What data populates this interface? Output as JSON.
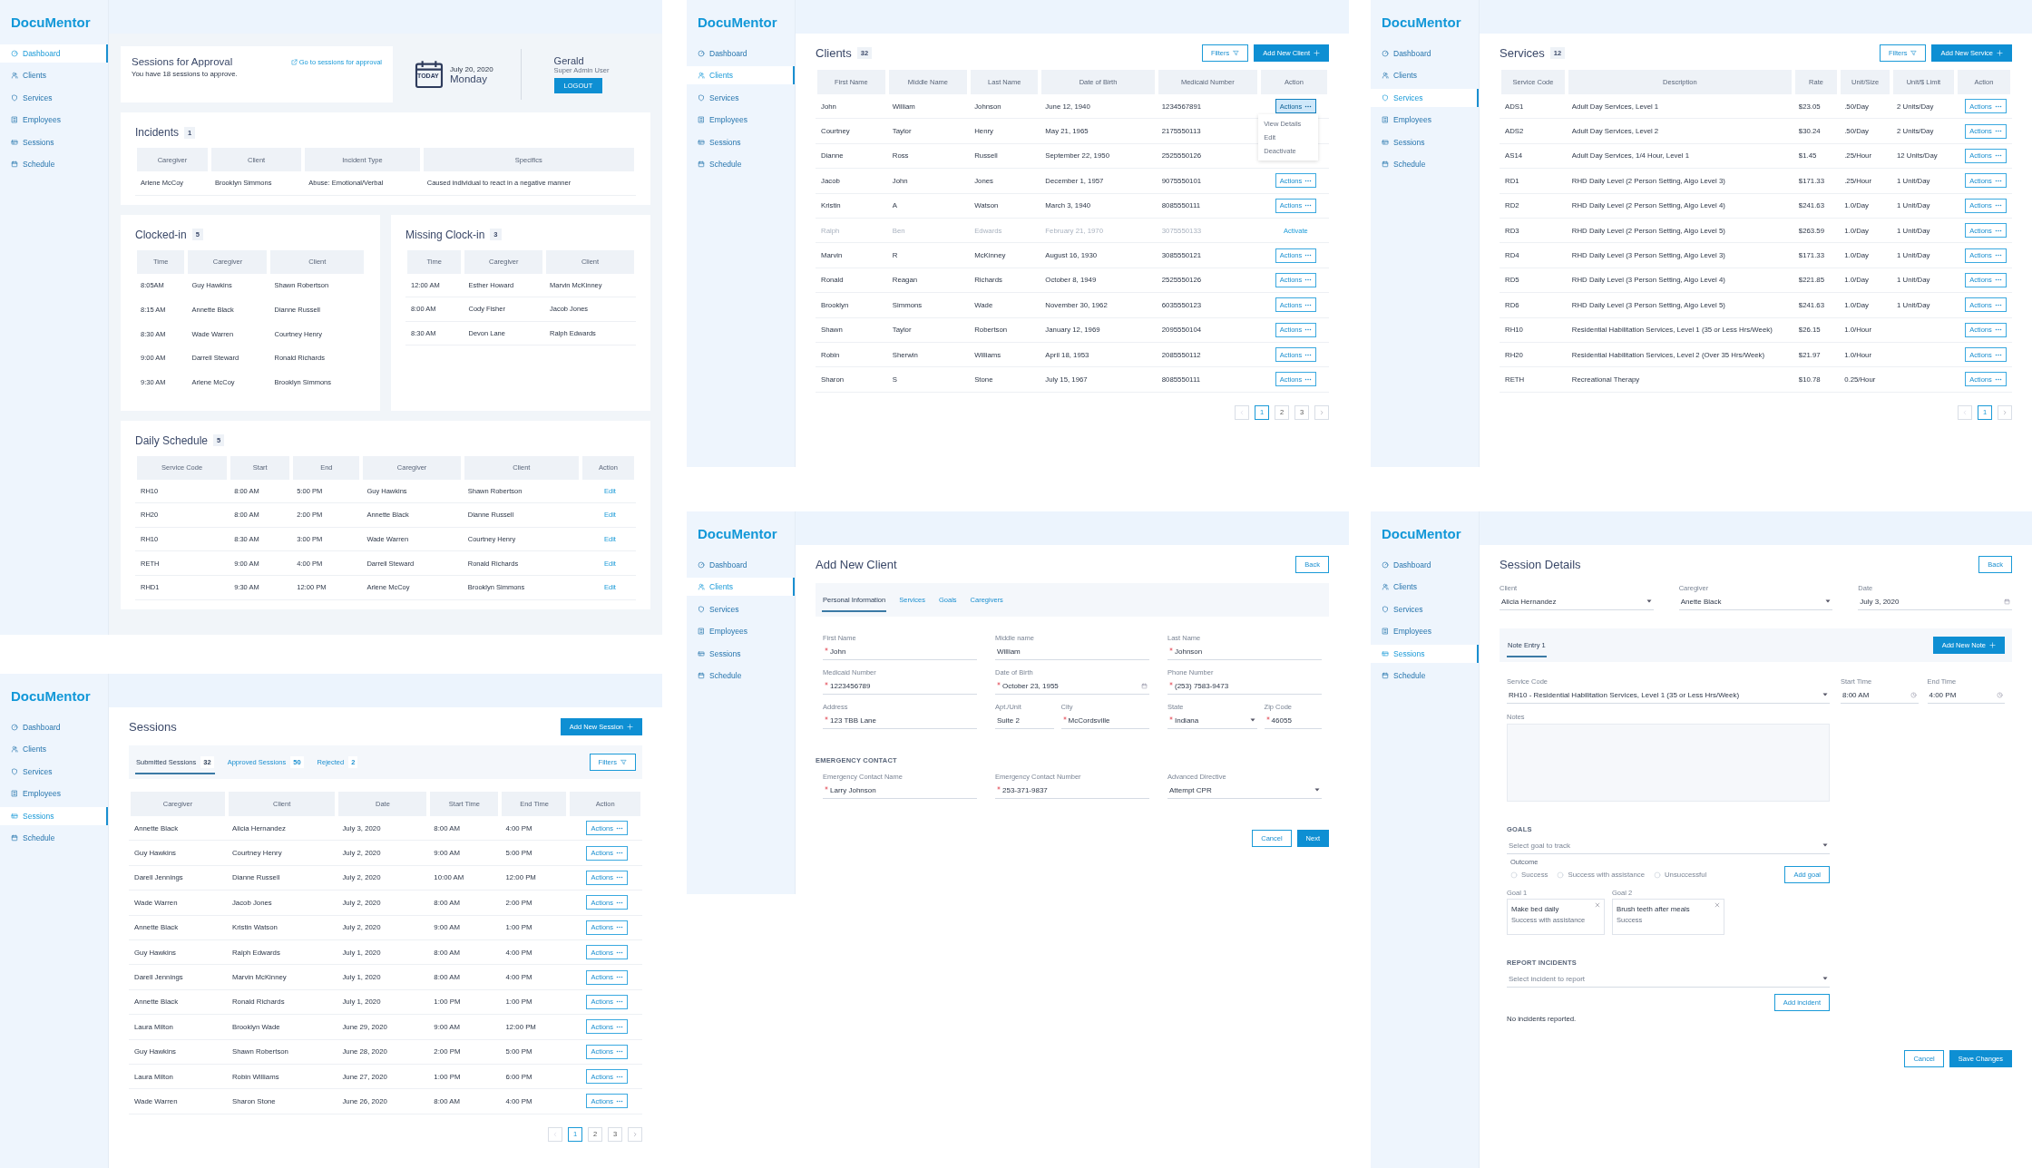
{
  "screens": [
    {
      "kind": "dashboard",
      "sidebar": {
        "logo": "DocuMentor",
        "items": [
          {
            "label": "Dashboard",
            "selected": true
          },
          {
            "label": "Clients",
            "selected": false
          },
          {
            "label": "Services",
            "selected": false
          },
          {
            "label": "Employees",
            "selected": false
          },
          {
            "label": "Sessions",
            "selected": false
          },
          {
            "label": "Schedule",
            "selected": false
          }
        ]
      },
      "approval": {
        "title": "Sessions for Approval",
        "text": "You have 18 sessions to approve.",
        "link": "Go to sessions for approval"
      },
      "date": {
        "badge": "TODAY",
        "date": "July 20, 2020",
        "day": "Monday"
      },
      "user": {
        "name": "Gerald",
        "role": "Super Admin User",
        "button": "LOGOUT"
      },
      "panels": [
        {
          "kind": "wide",
          "title": "Incidents",
          "count": "1",
          "table": {
            "columns": [
              "Caregiver",
              "Client",
              "Incident Type",
              "Specifics"
            ],
            "rows": [
              {
                "cells": [
                  "Arlene McCoy",
                  "Brooklyn Simmons",
                  "Abuse: Emotional/Verbal",
                  "Caused individual to react in a negative manner"
                ]
              }
            ]
          }
        },
        {
          "kind": "half",
          "title": "Clocked-in",
          "count": "5",
          "table": {
            "columns": [
              "Time",
              "Caregiver",
              "Client"
            ],
            "rows": [
              {
                "cells": [
                  "8:05AM",
                  "Guy Hawkins",
                  "Shawn Robertson"
                ]
              },
              {
                "cells": [
                  "8:15 AM",
                  "Annette Black",
                  "Dianne Russell"
                ]
              },
              {
                "cells": [
                  "8:30 AM",
                  "Wade Warren",
                  "Courtney Henry"
                ]
              },
              {
                "cells": [
                  "9:00 AM",
                  "Darrell Steward",
                  "Ronald Richards"
                ]
              },
              {
                "cells": [
                  "9:30 AM",
                  "Arlene McCoy",
                  "Brooklyn Simmons"
                ]
              }
            ]
          }
        },
        {
          "kind": "half",
          "title": "Missing Clock-in",
          "count": "3",
          "table": {
            "columns": [
              "Time",
              "Caregiver",
              "Client"
            ],
            "rows": [
              {
                "cells": [
                  "12:00 AM",
                  "Esther Howard",
                  "Marvin McKinney"
                ]
              },
              {
                "cells": [
                  "8:00 AM",
                  "Cody Fisher",
                  "Jacob Jones"
                ]
              },
              {
                "cells": [
                  "8:30 AM",
                  "Devon Lane",
                  "Ralph Edwards"
                ]
              }
            ]
          }
        },
        {
          "kind": "wide",
          "title": "Daily Schedule",
          "count": "5",
          "table": {
            "columns": [
              "Service Code",
              "Start",
              "End",
              "Caregiver",
              "Client",
              "Action"
            ],
            "rows": [
              {
                "cells": [
                  "RH10",
                  "8:00 AM",
                  "5:00 PM",
                  "Guy Hawkins",
                  "Shawn Robertson"
                ],
                "action": {
                  "kind": "link",
                  "label": "Edit"
                }
              },
              {
                "cells": [
                  "RH20",
                  "8:00 AM",
                  "2:00 PM",
                  "Annette Black",
                  "Dianne Russell"
                ],
                "action": {
                  "kind": "link",
                  "label": "Edit"
                }
              },
              {
                "cells": [
                  "RH10",
                  "8:30 AM",
                  "3:00 PM",
                  "Wade Warren",
                  "Courtney Henry"
                ],
                "action": {
                  "kind": "link",
                  "label": "Edit"
                }
              },
              {
                "cells": [
                  "RETH",
                  "9:00 AM",
                  "4:00 PM",
                  "Darrell Steward",
                  "Ronald Richards"
                ],
                "action": {
                  "kind": "link",
                  "label": "Edit"
                }
              },
              {
                "cells": [
                  "RHD1",
                  "9:30 AM",
                  "12:00 PM",
                  "Arlene McCoy",
                  "Brooklyn Simmons"
                ],
                "action": {
                  "kind": "link",
                  "label": "Edit"
                }
              }
            ]
          }
        }
      ]
    },
    {
      "kind": "list",
      "sidebar": {
        "logo": "DocuMentor",
        "items": [
          {
            "label": "Dashboard",
            "selected": false
          },
          {
            "label": "Clients",
            "selected": true
          },
          {
            "label": "Services",
            "selected": false
          },
          {
            "label": "Employees",
            "selected": false
          },
          {
            "label": "Sessions",
            "selected": false
          },
          {
            "label": "Schedule",
            "selected": false
          }
        ]
      },
      "title": "Clients",
      "count": "32",
      "filters": "Filters",
      "add_button": "Add New Client",
      "table": {
        "columns": [
          "First Name",
          "Middle Name",
          "Last Name",
          "Date of Birth",
          "Medicaid Number",
          "Action"
        ],
        "rows": [
          {
            "cells": [
              "John",
              "William",
              "Johnson",
              "June 12, 1940",
              "1234567891"
            ],
            "disabled": false,
            "action": {
              "kind": "menu",
              "label": "Actions",
              "expanded": true,
              "options": [
                "View Details",
                "Edit",
                "Deactivate"
              ]
            }
          },
          {
            "cells": [
              "Courtney",
              "Taylor",
              "Henry",
              "May 21, 1965",
              "2175550113"
            ],
            "disabled": false
          },
          {
            "cells": [
              "Dianne",
              "Ross",
              "Russell",
              "September 22, 1950",
              "2525550126"
            ],
            "disabled": false
          },
          {
            "cells": [
              "Jacob",
              "John",
              "Jones",
              "December 1, 1957",
              "9075550101"
            ],
            "disabled": false,
            "action": {
              "kind": "menu",
              "label": "Actions",
              "expanded": false
            }
          },
          {
            "cells": [
              "Kristin",
              "A",
              "Watson",
              "March 3, 1940",
              "8085550111"
            ],
            "disabled": false,
            "action": {
              "kind": "menu",
              "label": "Actions",
              "expanded": false
            }
          },
          {
            "cells": [
              "Ralph",
              "Ben",
              "Edwards",
              "February 21, 1970",
              "3075550133"
            ],
            "disabled": true,
            "action": {
              "kind": "link",
              "label": "Activate"
            }
          },
          {
            "cells": [
              "Marvin",
              "R",
              "McKinney",
              "August 16, 1930",
              "3085550121"
            ],
            "disabled": false,
            "action": {
              "kind": "menu",
              "label": "Actions",
              "expanded": false
            }
          },
          {
            "cells": [
              "Ronald",
              "Reagan",
              "Richards",
              "October 8, 1949",
              "2525550126"
            ],
            "disabled": false,
            "action": {
              "kind": "menu",
              "label": "Actions",
              "expanded": false
            }
          },
          {
            "cells": [
              "Brooklyn",
              "Simmons",
              "Wade",
              "November 30, 1962",
              "6035550123"
            ],
            "disabled": false,
            "action": {
              "kind": "menu",
              "label": "Actions",
              "expanded": false
            }
          },
          {
            "cells": [
              "Shawn",
              "Taylor",
              "Robertson",
              "January 12, 1969",
              "2095550104"
            ],
            "disabled": false,
            "action": {
              "kind": "menu",
              "label": "Actions",
              "expanded": false
            }
          },
          {
            "cells": [
              "Robin",
              "Sherwin",
              "Williams",
              "April 18, 1953",
              "2085550112"
            ],
            "disabled": false,
            "action": {
              "kind": "menu",
              "label": "Actions",
              "expanded": false
            }
          },
          {
            "cells": [
              "Sharon",
              "S",
              "Stone",
              "July 15, 1967",
              "8085550111"
            ],
            "disabled": false,
            "action": {
              "kind": "menu",
              "label": "Actions",
              "expanded": false
            }
          }
        ]
      },
      "pagination": [
        {
          "label": "1",
          "selected": true
        },
        {
          "label": "2",
          "selected": false
        },
        {
          "label": "3",
          "selected": false
        }
      ]
    },
    {
      "kind": "list",
      "sidebar": {
        "logo": "DocuMentor",
        "items": [
          {
            "label": "Dashboard",
            "selected": false
          },
          {
            "label": "Clients",
            "selected": false
          },
          {
            "label": "Services",
            "selected": true
          },
          {
            "label": "Employees",
            "selected": false
          },
          {
            "label": "Sessions",
            "selected": false
          },
          {
            "label": "Schedule",
            "selected": false
          }
        ]
      },
      "title": "Services",
      "count": "12",
      "filters": "Filters",
      "add_button": "Add New Service",
      "table": {
        "columns": [
          "Service Code",
          "Description",
          "Rate",
          "Unit/Size",
          "Unit/$ Limit",
          "Action"
        ],
        "rows": [
          {
            "cells": [
              "ADS1",
              "Adult Day Services, Level 1",
              "$23.05",
              ".50/Day",
              "2 Units/Day"
            ],
            "action": {
              "kind": "menu",
              "label": "Actions"
            }
          },
          {
            "cells": [
              "ADS2",
              "Adult Day Services, Level 2",
              "$30.24",
              ".50/Day",
              "2 Units/Day"
            ],
            "action": {
              "kind": "menu",
              "label": "Actions"
            }
          },
          {
            "cells": [
              "AS14",
              "Adult Day Services,  1/4 Hour, Level 1",
              "$1.45",
              ".25/Hour",
              "12 Units/Day"
            ],
            "action": {
              "kind": "menu",
              "label": "Actions"
            }
          },
          {
            "cells": [
              "RD1",
              "RHD Daily Level (2 Person Setting, Algo Level 3)",
              "$171.33",
              ".25/Hour",
              "1 Unit/Day"
            ],
            "action": {
              "kind": "menu",
              "label": "Actions"
            }
          },
          {
            "cells": [
              "RD2",
              "RHD Daily Level (2 Person Setting, Algo Level 4)",
              "$241.63",
              "1.0/Day",
              "1 Unit/Day"
            ],
            "action": {
              "kind": "menu",
              "label": "Actions"
            }
          },
          {
            "cells": [
              "RD3",
              "RHD Daily Level (2 Person Setting, Algo Level 5)",
              "$263.59",
              "1.0/Day",
              "1 Unit/Day"
            ],
            "action": {
              "kind": "menu",
              "label": "Actions"
            }
          },
          {
            "cells": [
              "RD4",
              "RHD Daily Level (3 Person Setting, Algo Level 3)",
              "$171.33",
              "1.0/Day",
              "1 Unit/Day"
            ],
            "action": {
              "kind": "menu",
              "label": "Actions"
            }
          },
          {
            "cells": [
              "RD5",
              "RHD Daily Level (3 Person Setting, Algo Level 4)",
              "$221.85",
              "1.0/Day",
              "1 Unit/Day"
            ],
            "action": {
              "kind": "menu",
              "label": "Actions"
            }
          },
          {
            "cells": [
              "RD6",
              "RHD Daily Level (3 Person Setting, Algo Level 5)",
              "$241.63",
              "1.0/Day",
              "1 Unit/Day"
            ],
            "action": {
              "kind": "menu",
              "label": "Actions"
            }
          },
          {
            "cells": [
              "RH10",
              "Residential Habilitation Services, Level 1 (35 or Less Hrs/Week)",
              "$26.15",
              "1.0/Hour",
              ""
            ],
            "action": {
              "kind": "menu",
              "label": "Actions"
            }
          },
          {
            "cells": [
              "RH20",
              "Residential Habilitation Services, Level 2 (Over 35 Hrs/Week)",
              "$21.97",
              "1.0/Hour",
              ""
            ],
            "action": {
              "kind": "menu",
              "label": "Actions"
            }
          },
          {
            "cells": [
              "RETH",
              "Recreational Therapy",
              "$10.78",
              "0.25/Hour",
              ""
            ],
            "action": {
              "kind": "menu",
              "label": "Actions"
            }
          }
        ]
      },
      "pagination": [
        {
          "label": "1",
          "selected": true
        }
      ]
    },
    {
      "kind": "list",
      "sidebar": {
        "logo": "DocuMentor",
        "items": [
          {
            "label": "Dashboard",
            "selected": false
          },
          {
            "label": "Clients",
            "selected": false
          },
          {
            "label": "Services",
            "selected": false
          },
          {
            "label": "Employees",
            "selected": false
          },
          {
            "label": "Sessions",
            "selected": true
          },
          {
            "label": "Schedule",
            "selected": false
          }
        ]
      },
      "title": "Sessions",
      "add_button": "Add New Session",
      "filters": "Filters",
      "tabs": [
        {
          "label": "Submitted Sessions",
          "count": "32",
          "selected": true
        },
        {
          "label": "Approved Sessions",
          "count": "50",
          "selected": false
        },
        {
          "label": "Rejected",
          "count": "2",
          "selected": false
        }
      ],
      "table": {
        "columns": [
          "Caregiver",
          "Client",
          "Date",
          "Start Time",
          "End Time",
          "Action"
        ],
        "rows": [
          {
            "cells": [
              "Annette Black",
              "Alicia Hernandez",
              "July 3, 2020",
              "8:00 AM",
              "4:00 PM"
            ],
            "action": {
              "kind": "menu",
              "label": "Actions"
            }
          },
          {
            "cells": [
              "Guy Hawkins",
              "Courtney Henry",
              "July 2, 2020",
              "9:00 AM",
              "5:00 PM"
            ],
            "action": {
              "kind": "menu",
              "label": "Actions"
            }
          },
          {
            "cells": [
              "Darell Jennings",
              "Dianne Russell",
              "July 2, 2020",
              "10:00 AM",
              "12:00 PM"
            ],
            "action": {
              "kind": "menu",
              "label": "Actions"
            }
          },
          {
            "cells": [
              "Wade Warren",
              "Jacob Jones",
              "July 2, 2020",
              "8:00 AM",
              "2:00 PM"
            ],
            "action": {
              "kind": "menu",
              "label": "Actions"
            }
          },
          {
            "cells": [
              "Annette Black",
              "Kristin Watson",
              "July 2, 2020",
              "9:00 AM",
              "1:00 PM"
            ],
            "action": {
              "kind": "menu",
              "label": "Actions"
            }
          },
          {
            "cells": [
              "Guy Hawkins",
              "Ralph Edwards",
              "July 1, 2020",
              "8:00 AM",
              "4:00 PM"
            ],
            "action": {
              "kind": "menu",
              "label": "Actions"
            }
          },
          {
            "cells": [
              "Darell Jennings",
              "Marvin McKinney",
              "July 1, 2020",
              "8:00 AM",
              "4:00 PM"
            ],
            "action": {
              "kind": "menu",
              "label": "Actions"
            }
          },
          {
            "cells": [
              "Annette Black",
              "Ronald Richards",
              "July 1, 2020",
              "1:00 PM",
              "1:00 PM"
            ],
            "action": {
              "kind": "menu",
              "label": "Actions"
            }
          },
          {
            "cells": [
              "Laura Milton",
              "Brooklyn Wade",
              "June 29, 2020",
              "9:00 AM",
              "12:00 PM"
            ],
            "action": {
              "kind": "menu",
              "label": "Actions"
            }
          },
          {
            "cells": [
              "Guy Hawkins",
              "Shawn Robertson",
              "June 28, 2020",
              "2:00 PM",
              "5:00 PM"
            ],
            "action": {
              "kind": "menu",
              "label": "Actions"
            }
          },
          {
            "cells": [
              "Laura Milton",
              "Robin Williams",
              "June 27, 2020",
              "1:00 PM",
              "6:00 PM"
            ],
            "action": {
              "kind": "menu",
              "label": "Actions"
            }
          },
          {
            "cells": [
              "Wade Warren",
              "Sharon Stone",
              "June 26, 2020",
              "8:00 AM",
              "4:00 PM"
            ],
            "action": {
              "kind": "menu",
              "label": "Actions"
            }
          }
        ]
      },
      "pagination": [
        {
          "label": "1",
          "selected": true
        },
        {
          "label": "2",
          "selected": false
        },
        {
          "label": "3",
          "selected": false
        }
      ]
    },
    {
      "kind": "form",
      "sidebar": {
        "logo": "DocuMentor",
        "items": [
          {
            "label": "Dashboard",
            "selected": false
          },
          {
            "label": "Clients",
            "selected": true
          },
          {
            "label": "Services",
            "selected": false
          },
          {
            "label": "Employees",
            "selected": false
          },
          {
            "label": "Sessions",
            "selected": false
          },
          {
            "label": "Schedule",
            "selected": false
          }
        ]
      },
      "title": "Add New Client",
      "back": "Back",
      "tabs": [
        {
          "label": "Personal Information",
          "selected": true
        },
        {
          "label": "Services",
          "selected": false
        },
        {
          "label": "Goals",
          "selected": false
        },
        {
          "label": "Caregivers",
          "selected": false
        }
      ],
      "sections": [
        {
          "rows": [
            [
              [
                {
                  "label": "First Name",
                  "value": "John",
                  "required": true,
                  "kind": "text"
                }
              ],
              [
                {
                  "label": "Middle name",
                  "value": "William",
                  "required": false,
                  "kind": "text"
                }
              ],
              [
                {
                  "label": "Last Name",
                  "value": "Johnson",
                  "required": true,
                  "kind": "text"
                }
              ]
            ],
            [
              [
                {
                  "label": "Medicaid Number",
                  "value": "1223456789",
                  "required": true,
                  "kind": "text"
                }
              ],
              [
                {
                  "label": "Date of Birth",
                  "value": "October 23, 1955",
                  "required": true,
                  "kind": "date"
                }
              ],
              [
                {
                  "label": "Phone Number",
                  "value": "(253) 7583-9473",
                  "required": true,
                  "kind": "text"
                }
              ]
            ],
            [
              [
                {
                  "label": "Address",
                  "value": "123 TBB Lane",
                  "required": true,
                  "kind": "text"
                }
              ],
              [
                {
                  "label": "Apt./Unit",
                  "value": "Suite 2",
                  "required": false,
                  "kind": "text"
                },
                {
                  "label": "City",
                  "value": "McCordsville",
                  "required": true,
                  "kind": "text"
                }
              ],
              [
                {
                  "label": "State",
                  "value": "Indiana",
                  "required": true,
                  "kind": "select"
                },
                {
                  "label": "Zip Code",
                  "value": "46055",
                  "required": true,
                  "kind": "text"
                }
              ]
            ]
          ]
        },
        {
          "heading": "EMERGENCY CONTACT",
          "rows": [
            [
              [
                {
                  "label": "Emergency Contact Name",
                  "value": "Larry Johnson",
                  "required": true,
                  "kind": "text"
                }
              ],
              [
                {
                  "label": "Emergency Contact Number",
                  "value": "253-371-9837",
                  "required": true,
                  "kind": "text"
                }
              ],
              [
                {
                  "label": "Advanced Directive",
                  "value": "Attempt CPR",
                  "required": false,
                  "kind": "select"
                }
              ]
            ]
          ]
        }
      ],
      "buttons": [
        {
          "label": "Cancel",
          "kind": "secondary"
        },
        {
          "label": "Next",
          "kind": "primary"
        }
      ]
    },
    {
      "kind": "session",
      "sidebar": {
        "logo": "DocuMentor",
        "items": [
          {
            "label": "Dashboard",
            "selected": false
          },
          {
            "label": "Clients",
            "selected": false
          },
          {
            "label": "Services",
            "selected": false
          },
          {
            "label": "Employees",
            "selected": false
          },
          {
            "label": "Sessions",
            "selected": true
          },
          {
            "label": "Schedule",
            "selected": false
          }
        ]
      },
      "title": "Session Details",
      "back": "Back",
      "fields": [
        {
          "label": "Client",
          "value": "Alicia Hernandez",
          "kind": "select"
        },
        {
          "label": "Caregiver",
          "value": "Anette Black",
          "kind": "select"
        },
        {
          "label": "Date",
          "value": "July 3, 2020",
          "kind": "date"
        }
      ],
      "note_tabs": [
        {
          "label": "Note Entry 1",
          "selected": true
        }
      ],
      "add_note": "Add New Note",
      "service": {
        "label": "Service Code",
        "value": "RH10 - Residential Habilitation Services, Level 1 (35 or Less Hrs/Week)",
        "kind": "select"
      },
      "times": [
        {
          "label": "Start Time",
          "value": "8:00 AM",
          "kind": "time"
        },
        {
          "label": "End Time",
          "value": "4:00 PM",
          "kind": "time"
        }
      ],
      "notes": {
        "label": "Notes"
      },
      "goals": {
        "heading": "GOALS",
        "select": {
          "placeholder": "Select goal to track",
          "kind": "select"
        },
        "outcome_label": "Outcome",
        "options": [
          {
            "label": "Success",
            "selected": false
          },
          {
            "label": "Success with assistance",
            "selected": false
          },
          {
            "label": "Unsuccessful",
            "selected": false
          }
        ],
        "add": "Add goal",
        "cards": [
          {
            "label": "Goal 1",
            "title": "Make bed daily",
            "outcome": "Success with assistance"
          },
          {
            "label": "Goal 2",
            "title": "Brush teeth after meals",
            "outcome": "Success"
          }
        ]
      },
      "incidents": {
        "heading": "REPORT INCIDENTS",
        "select": {
          "placeholder": "Select incident to report",
          "kind": "select"
        },
        "add": "Add incident",
        "empty": "No incidents reported."
      },
      "buttons": [
        {
          "label": "Cancel",
          "kind": "secondary"
        },
        {
          "label": "Save Changes",
          "kind": "primary"
        }
      ]
    }
  ]
}
